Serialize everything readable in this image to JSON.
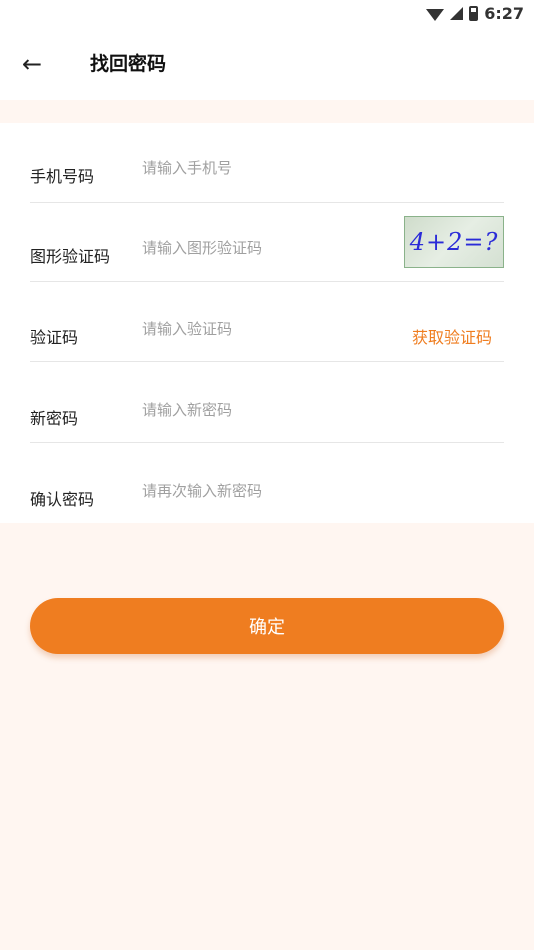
{
  "status_bar": {
    "time": "6:27"
  },
  "header": {
    "title": "找回密码"
  },
  "form": {
    "phone": {
      "label": "手机号码",
      "placeholder": "请输入手机号"
    },
    "captcha_image": {
      "label": "图形验证码",
      "placeholder": "请输入图形验证码",
      "captcha_text": "4+2=?"
    },
    "sms_code": {
      "label": "验证码",
      "placeholder": "请输入验证码",
      "action": "获取验证码"
    },
    "new_password": {
      "label": "新密码",
      "placeholder": "请输入新密码"
    },
    "confirm_password": {
      "label": "确认密码",
      "placeholder": "请再次输入新密码"
    }
  },
  "confirm_button": {
    "label": "确定"
  },
  "colors": {
    "accent": "#ef7d20",
    "background": "#fff6f1"
  }
}
